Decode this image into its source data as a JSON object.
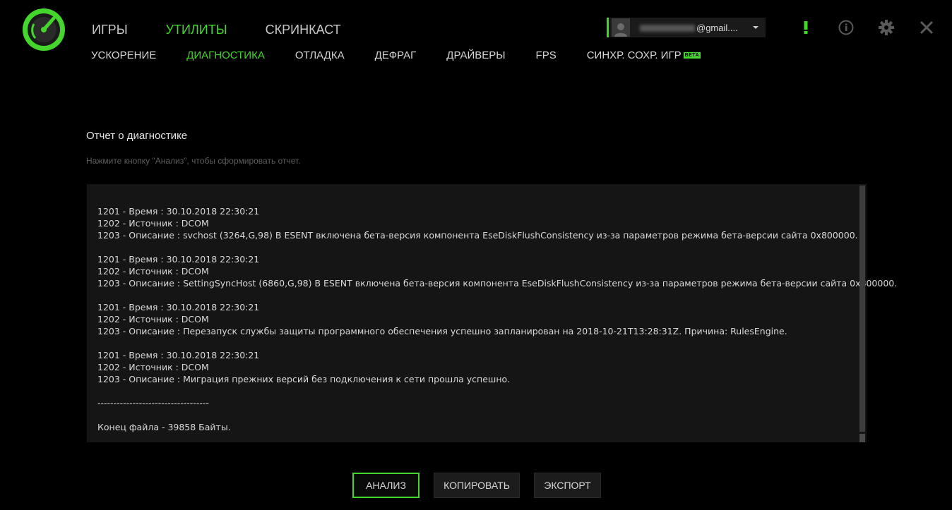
{
  "colors": {
    "accent": "#44d62c",
    "background": "#000000",
    "panel": "#151515"
  },
  "nav": {
    "main_tabs": [
      {
        "label": "ИГРЫ",
        "active": false
      },
      {
        "label": "УТИЛИТЫ",
        "active": true
      },
      {
        "label": "СКРИНКАСТ",
        "active": false
      }
    ],
    "sub_tabs": [
      {
        "label": "УСКОРЕНИЕ",
        "active": false
      },
      {
        "label": "ДИАГНОСТИКА",
        "active": true
      },
      {
        "label": "ОТЛАДКА",
        "active": false
      },
      {
        "label": "ДЕФРАГ",
        "active": false
      },
      {
        "label": "ДРАЙВЕРЫ",
        "active": false
      },
      {
        "label": "FPS",
        "active": false
      },
      {
        "label": "СИНХР. СОХР. ИГР",
        "active": false,
        "badge": "BETA"
      }
    ]
  },
  "account": {
    "email_visible": "@gmail....",
    "icon": "chevron-down-icon"
  },
  "top_icons": [
    "alert-icon",
    "info-icon",
    "gear-icon",
    "close-icon"
  ],
  "content": {
    "title": "Отчет о диагностике",
    "hint": "Нажмите кнопку \"Анализ\", чтобы сформировать отчет.",
    "report_lines": [
      "1201 - Время : 30.10.2018 22:30:21",
      "1202 - Источник : DCOM",
      "1203 - Описание : svchost (3264,G,98) В ESENT включена бета-версия компонента EseDiskFlushConsistency из-за параметров режима бета-версии сайта 0x800000.",
      "",
      "1201 - Время : 30.10.2018 22:30:21",
      "1202 - Источник : DCOM",
      "1203 - Описание : SettingSyncHost (6860,G,98) В ESENT включена бета-версия компонента EseDiskFlushConsistency из-за параметров режима бета-версии сайта 0x800000.",
      "",
      "1201 - Время : 30.10.2018 22:30:21",
      "1202 - Источник : DCOM",
      "1203 - Описание : Перезапуск службы защиты программного обеспечения успешно запланирован на 2018-10-21T13:28:31Z. Причина: RulesEngine.",
      "",
      "1201 - Время : 30.10.2018 22:30:21",
      "1202 - Источник : DCOM",
      "1203 - Описание : Миграция прежних версий без подключения к сети прошла успешно.",
      "",
      "-----------------------------------",
      "",
      "Конец файла - 39858 Байты."
    ]
  },
  "buttons": {
    "analyze": "АНАЛИЗ",
    "copy": "КОПИРОВАТЬ",
    "export": "ЭКСПОРТ"
  }
}
